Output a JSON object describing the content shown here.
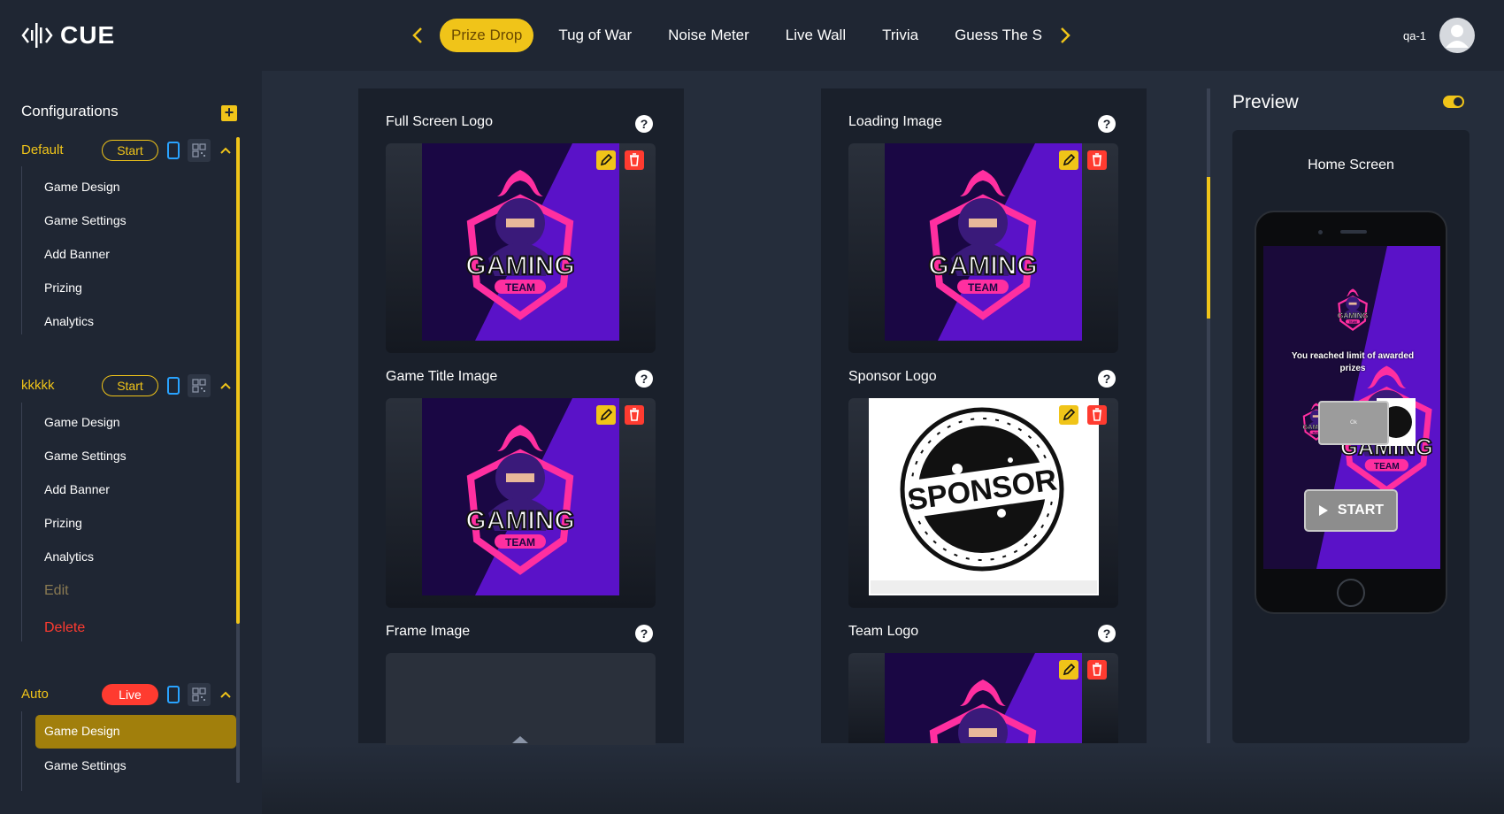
{
  "app": {
    "name": "CUE",
    "user": "qa-1"
  },
  "tabs": [
    {
      "label": "Prize Drop",
      "active": true
    },
    {
      "label": "Tug of War"
    },
    {
      "label": "Noise Meter"
    },
    {
      "label": "Live Wall"
    },
    {
      "label": "Trivia"
    },
    {
      "label": "Guess The Sc"
    }
  ],
  "sidebar": {
    "heading": "Configurations",
    "add_label": "+",
    "groups": [
      {
        "name": "Default",
        "status": "Start",
        "items": [
          "Game Design",
          "Game Settings",
          "Add Banner",
          "Prizing",
          "Analytics"
        ]
      },
      {
        "name": "kkkkk",
        "status": "Start",
        "items": [
          "Game Design",
          "Game Settings",
          "Add Banner",
          "Prizing",
          "Analytics"
        ],
        "edit": "Edit",
        "delete": "Delete"
      },
      {
        "name": "Auto",
        "status": "Live",
        "items": [
          "Game Design",
          "Game Settings"
        ]
      }
    ]
  },
  "fields": {
    "full_screen_logo": "Full Screen Logo",
    "loading_image": "Loading Image",
    "game_title_image": "Game Title Image",
    "sponsor_logo": "Sponsor Logo",
    "frame_image": "Frame Image",
    "team_logo": "Team Logo",
    "help": "?"
  },
  "logo_art": {
    "word": "GAMING",
    "sub": "TEAM",
    "sponsor": "SPONSOR"
  },
  "preview": {
    "title": "Preview",
    "screen_label": "Home Screen",
    "message": "You reached limit of awarded prizes",
    "ok": "Ok",
    "start": "START"
  },
  "colors": {
    "accent": "#f0c419",
    "danger": "#ff3b30",
    "bg": "#252d3b",
    "panel": "#1f2633",
    "logo_purple": "#5a12c8",
    "logo_pink": "#ff2fa0"
  }
}
